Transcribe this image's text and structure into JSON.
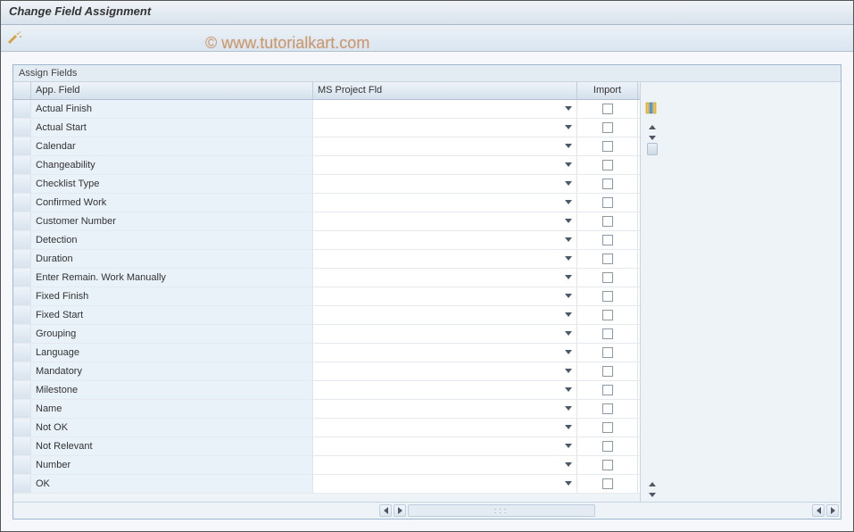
{
  "header": {
    "title": "Change Field Assignment"
  },
  "watermark": "© www.tutorialkart.com",
  "panel": {
    "title": "Assign Fields"
  },
  "columns": {
    "app_field": "App. Field",
    "ms_project": "MS Project Fld",
    "import": "Import"
  },
  "rows": [
    {
      "app": "Actual Finish",
      "msp": "",
      "import": false
    },
    {
      "app": "Actual Start",
      "msp": "",
      "import": false
    },
    {
      "app": "Calendar",
      "msp": "",
      "import": false
    },
    {
      "app": "Changeability",
      "msp": "",
      "import": false
    },
    {
      "app": "Checklist Type",
      "msp": "",
      "import": false
    },
    {
      "app": "Confirmed Work",
      "msp": "",
      "import": false
    },
    {
      "app": "Customer Number",
      "msp": "",
      "import": false
    },
    {
      "app": "Detection",
      "msp": "",
      "import": false
    },
    {
      "app": "Duration",
      "msp": "",
      "import": false
    },
    {
      "app": "Enter Remain. Work Manually",
      "msp": "",
      "import": false
    },
    {
      "app": "Fixed Finish",
      "msp": "",
      "import": false
    },
    {
      "app": "Fixed Start",
      "msp": "",
      "import": false
    },
    {
      "app": "Grouping",
      "msp": "",
      "import": false
    },
    {
      "app": "Language",
      "msp": "",
      "import": false
    },
    {
      "app": "Mandatory",
      "msp": "",
      "import": false
    },
    {
      "app": "Milestone",
      "msp": "",
      "import": false
    },
    {
      "app": "Name",
      "msp": "",
      "import": false
    },
    {
      "app": "Not OK",
      "msp": "",
      "import": false
    },
    {
      "app": "Not Relevant",
      "msp": "",
      "import": false
    },
    {
      "app": "Number",
      "msp": "",
      "import": false
    },
    {
      "app": "OK",
      "msp": "",
      "import": false
    }
  ]
}
